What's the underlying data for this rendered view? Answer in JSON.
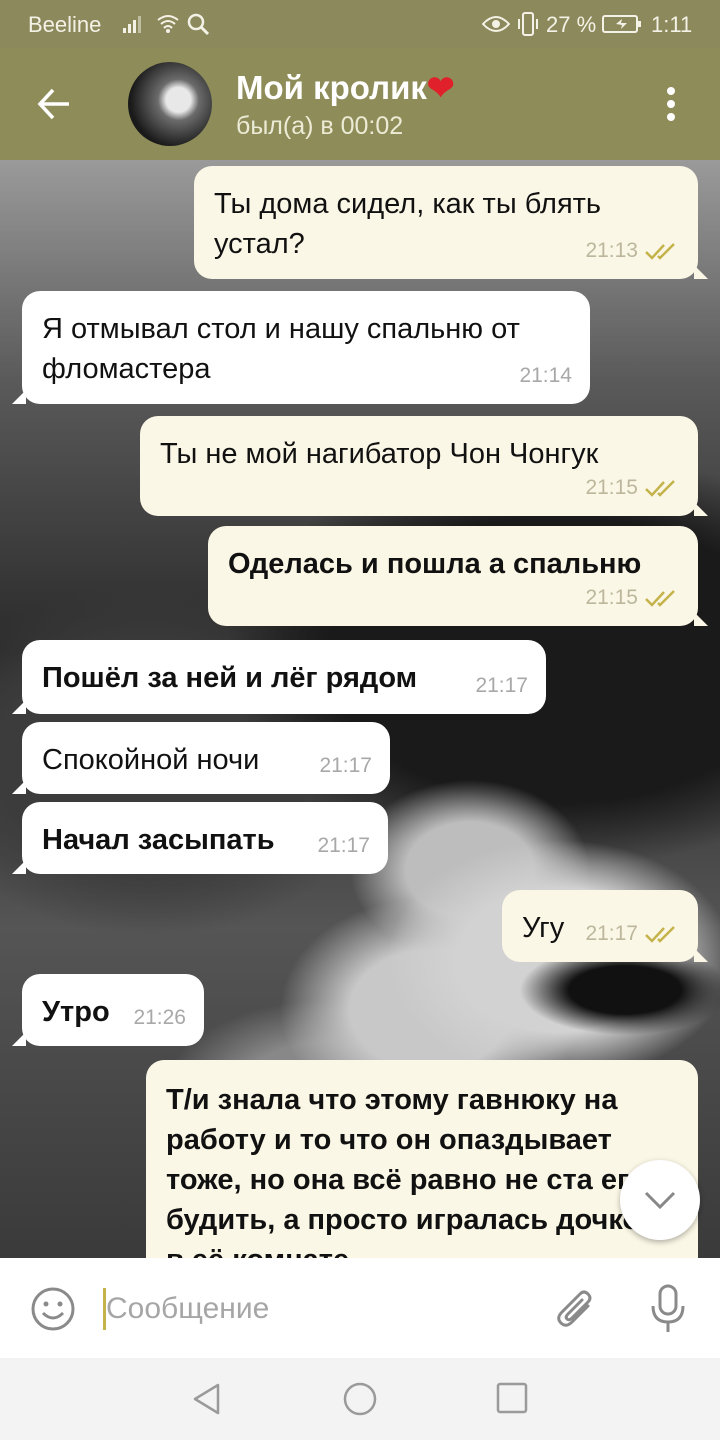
{
  "status_bar": {
    "carrier": "Beeline",
    "battery_percent": "27 %",
    "time": "1:11",
    "icons": [
      "signal-icon",
      "wifi-icon",
      "search-icon",
      "eye-icon",
      "vibrate-icon",
      "battery-icon"
    ]
  },
  "header": {
    "title": "Мой кролик",
    "title_emoji": "❤",
    "subtitle": "был(а) в 00:02"
  },
  "messages": [
    {
      "direction": "out",
      "text": "Ты дома сидел, как ты блять устал?",
      "time": "21:13",
      "read": true,
      "bold": false
    },
    {
      "direction": "in",
      "text": "Я отмывал стол и нашу спальню от фломастера",
      "time": "21:14",
      "bold": false
    },
    {
      "direction": "out",
      "text": "Ты не мой нагибатор Чон Чонгук",
      "time": "21:15",
      "read": true,
      "bold": false
    },
    {
      "direction": "out",
      "text": "Оделась и пошла а спальню",
      "time": "21:15",
      "read": true,
      "bold": true
    },
    {
      "direction": "in",
      "text": "Пошёл за ней и лёг рядом",
      "time": "21:17",
      "bold": true
    },
    {
      "direction": "in",
      "text": "Спокойной ночи",
      "time": "21:17",
      "bold": false
    },
    {
      "direction": "in",
      "text": "Начал засыпать",
      "time": "21:17",
      "bold": true
    },
    {
      "direction": "out",
      "text": "Угу",
      "time": "21:17",
      "read": true,
      "bold": false
    },
    {
      "direction": "in",
      "text": "Утро",
      "time": "21:26",
      "bold": true
    },
    {
      "direction": "out",
      "text": "Т/и знала что этому гавнюку на работу и то что он опаздывает тоже, но она всё равно не ста его будить, а просто игралась дочкой в её комнате",
      "bold": true,
      "partial": true
    }
  ],
  "input": {
    "placeholder": "Сообщение",
    "value": ""
  },
  "colors": {
    "header": "#8e8c58",
    "status_bar": "#8c8a5c",
    "outgoing_bubble": "#fbf7e6",
    "incoming_bubble": "#ffffff",
    "check": "#c4b24a"
  }
}
